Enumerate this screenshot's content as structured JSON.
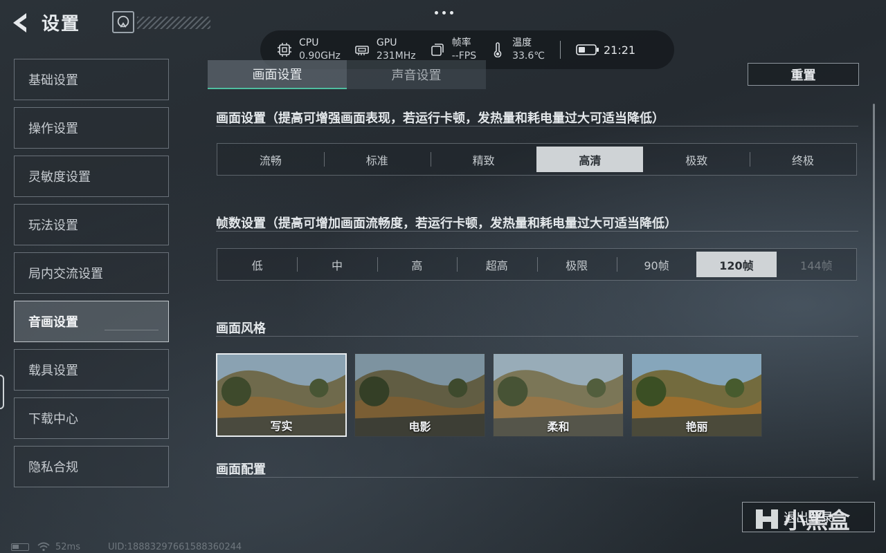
{
  "header": {
    "title": "设置"
  },
  "status_bar": {
    "cpu_label": "CPU",
    "cpu_value": "0.90GHz",
    "gpu_label": "GPU",
    "gpu_value": "231MHz",
    "fps_label": "帧率",
    "fps_value": "--FPS",
    "temp_label": "温度",
    "temp_value": "33.6℃",
    "time": "21:21"
  },
  "sidebar": {
    "items": [
      {
        "label": "基础设置",
        "active": false
      },
      {
        "label": "操作设置",
        "active": false
      },
      {
        "label": "灵敏度设置",
        "active": false
      },
      {
        "label": "玩法设置",
        "active": false
      },
      {
        "label": "局内交流设置",
        "active": false
      },
      {
        "label": "音画设置",
        "active": true
      },
      {
        "label": "载具设置",
        "active": false
      },
      {
        "label": "下载中心",
        "active": false
      },
      {
        "label": "隐私合规",
        "active": false
      }
    ]
  },
  "tabs": [
    {
      "label": "画面设置",
      "active": true
    },
    {
      "label": "声音设置",
      "active": false
    }
  ],
  "reset_label": "重置",
  "graphics": {
    "title": "画面设置（提高可增强画面表现，若运行卡顿，发热量和耗电量过大可适当降低）",
    "options": [
      "流畅",
      "标准",
      "精致",
      "高清",
      "极致",
      "终极"
    ],
    "selected": "高清"
  },
  "framerate": {
    "title": "帧数设置（提高可增加画面流畅度，若运行卡顿，发热量和耗电量过大可适当降低）",
    "options": [
      "低",
      "中",
      "高",
      "超高",
      "极限",
      "90帧",
      "120帧",
      "144帧"
    ],
    "selected": "120帧",
    "disabled": [
      "144帧"
    ]
  },
  "style": {
    "title": "画面风格",
    "cards": [
      {
        "label": "写实",
        "selected": true
      },
      {
        "label": "电影",
        "selected": false
      },
      {
        "label": "柔和",
        "selected": false
      },
      {
        "label": "艳丽",
        "selected": false
      }
    ]
  },
  "config": {
    "title": "画面配置"
  },
  "exit_label": "退出登录",
  "watermark": "小黑盒",
  "footer": {
    "ping": "52ms",
    "uid": "UID:18883297661588360244"
  },
  "colors": {
    "accent": "#4fbfa0",
    "selected_option_bg": "#cfd3d6"
  }
}
